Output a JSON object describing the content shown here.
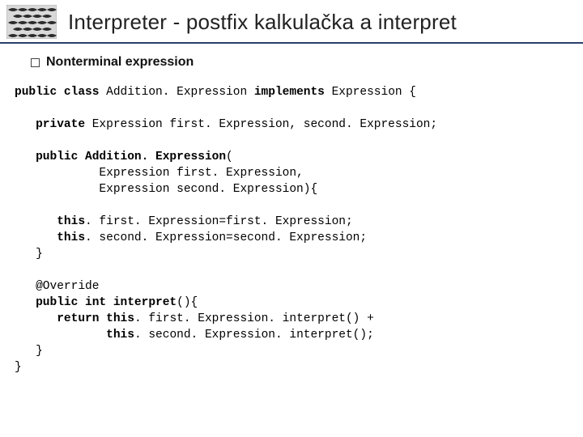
{
  "slide": {
    "title": "Interpreter - postfix kalkulačka a interpret",
    "subhead": "Nonterminal expression"
  },
  "code": {
    "l01a": "public class",
    "l01b": " Addition. Expression ",
    "l01c": "implements",
    "l01d": " Expression {",
    "l02a": "   private",
    "l02b": " Expression first. Expression, second. Expression;",
    "l03a": "   public Addition. Expression",
    "l03b": "(",
    "l04": "            Expression first. Expression,",
    "l05": "            Expression second. Expression){",
    "l06a": "      this",
    "l06b": ". first. Expression=first. Expression;",
    "l07a": "      this",
    "l07b": ". second. Expression=second. Expression;",
    "l08": "   }",
    "l09": "   @Override",
    "l10a": "   public int interpret",
    "l10b": "(){",
    "l11a": "      return this",
    "l11b": ". first. Expression. interpret() +",
    "l12a": "             this",
    "l12b": ". second. Expression. interpret();",
    "l13": "   }",
    "l14": "}"
  }
}
